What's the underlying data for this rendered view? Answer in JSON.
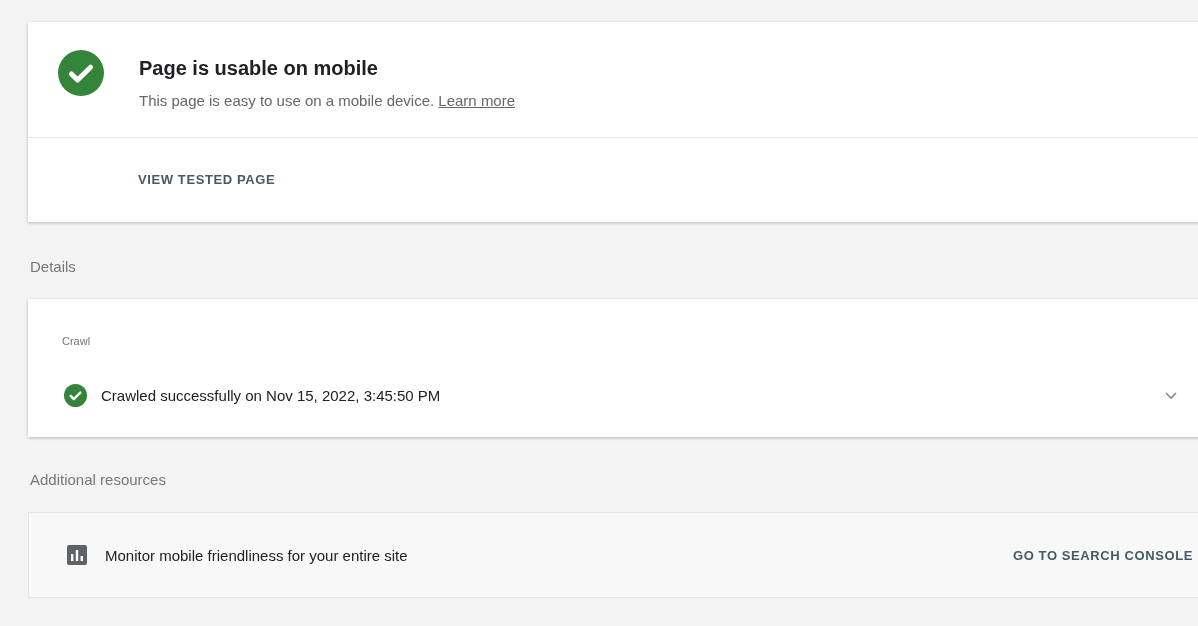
{
  "result": {
    "passed": true,
    "title": "Page is usable on mobile",
    "description": "This page is easy to use on a mobile device.",
    "link": "Learn more",
    "action": "VIEW TESTED PAGE"
  },
  "details": {
    "heading": "Details",
    "section": "Crawl",
    "items": [
      {
        "passed": true,
        "text": "Crawled successfully on Nov 15, 2022, 3:45:50 PM",
        "expanded": false
      }
    ]
  },
  "additional_resources": {
    "heading": "Additional resources",
    "items": [
      {
        "text": "Monitor mobile friendliness for your entire site",
        "action": "GO TO SEARCH CONSOLE"
      }
    ]
  }
}
